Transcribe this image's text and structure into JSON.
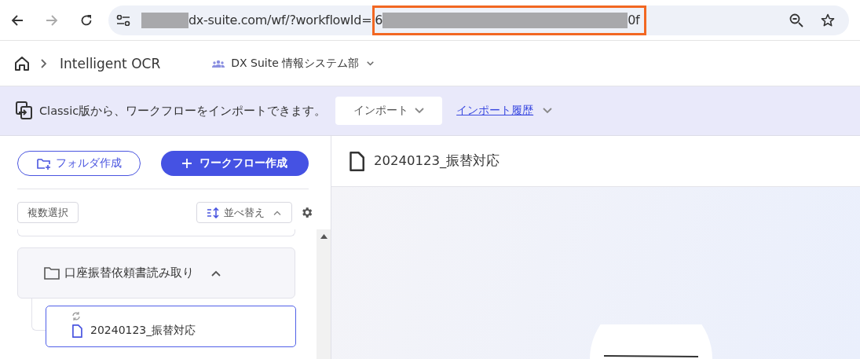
{
  "address_bar": {
    "url_visible": "dx-suite.com/wf/?workflowId=",
    "highlighted_start": "6",
    "highlighted_end": "0f"
  },
  "header": {
    "app_name": "Intelligent OCR",
    "workspace": "DX Suite 情報システム部"
  },
  "banner": {
    "message": "Classic版から、ワークフローをインポートできます。",
    "import_button": "インポート",
    "history_link": "インポート履歴"
  },
  "sidebar": {
    "create_folder": "フォルダ作成",
    "create_workflow": "ワークフロー作成",
    "multi_select": "複数選択",
    "sort": "並べ替え",
    "tree": [
      {
        "kind": "folder",
        "label": "口座振替依頼書読み取り",
        "expanded": true,
        "selected": false,
        "children": [
          {
            "kind": "workflow",
            "label": "20240123_振替対応",
            "selected": true
          }
        ]
      }
    ]
  },
  "main": {
    "title": "20240123_振替対応"
  }
}
